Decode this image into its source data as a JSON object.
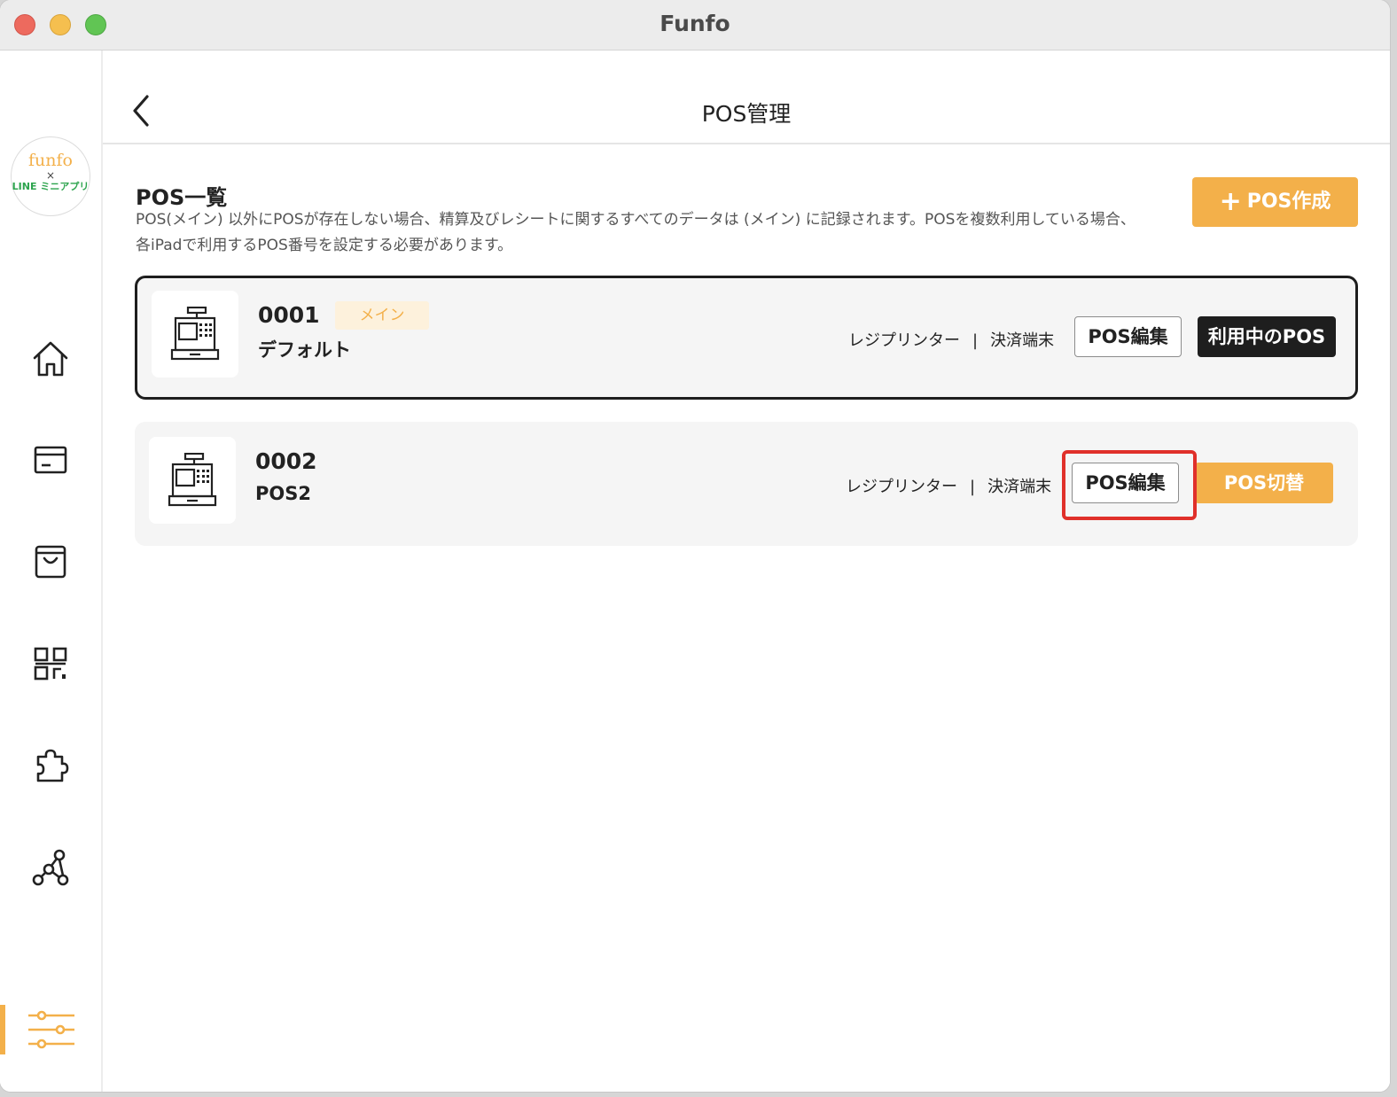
{
  "window": {
    "title": "Funfo"
  },
  "sidebar": {
    "logo": {
      "brand": "funfo",
      "cross": "×",
      "partner": "LINE ミニアプリ"
    },
    "items": [
      {
        "name": "home",
        "icon": "home-icon"
      },
      {
        "name": "payment",
        "icon": "card-icon"
      },
      {
        "name": "orders",
        "icon": "shopping-bag-icon"
      },
      {
        "name": "qr",
        "icon": "qr-code-icon"
      },
      {
        "name": "extensions",
        "icon": "puzzle-icon"
      },
      {
        "name": "integrations",
        "icon": "network-icon"
      },
      {
        "name": "settings",
        "icon": "sliders-icon",
        "active": true
      }
    ],
    "accent_color": "#f3b04a"
  },
  "header": {
    "title": "POS管理",
    "back_icon": "chevron-left-icon"
  },
  "section": {
    "title": "POS一覧",
    "description_line1": "POS(メイン) 以外にPOSが存在しない場合、精算及びレシートに関するすべてのデータは (メイン) に記録されます。POSを複数利用している場合、",
    "description_line2": "各iPadで利用するPOS番号を設定する必要があります。",
    "create_button": {
      "plus": "+",
      "label": "POS作成"
    }
  },
  "pos_list": [
    {
      "number": "0001",
      "badge": "メイン",
      "name": "デフォルト",
      "printer": "レジプリンター",
      "separator": "|",
      "terminal": "決済端末",
      "edit_label": "POS編集",
      "status_label": "利用中のPOS",
      "selected": true
    },
    {
      "number": "0002",
      "badge": "",
      "name": "POS2",
      "printer": "レジプリンター",
      "separator": "|",
      "terminal": "決済端末",
      "edit_label": "POS編集",
      "status_label": "POS切替",
      "selected": false
    }
  ],
  "colors": {
    "accent": "#f3b04a",
    "dark": "#1e1e1e",
    "highlight": "#e0302a",
    "card_bg": "#f5f5f5"
  }
}
